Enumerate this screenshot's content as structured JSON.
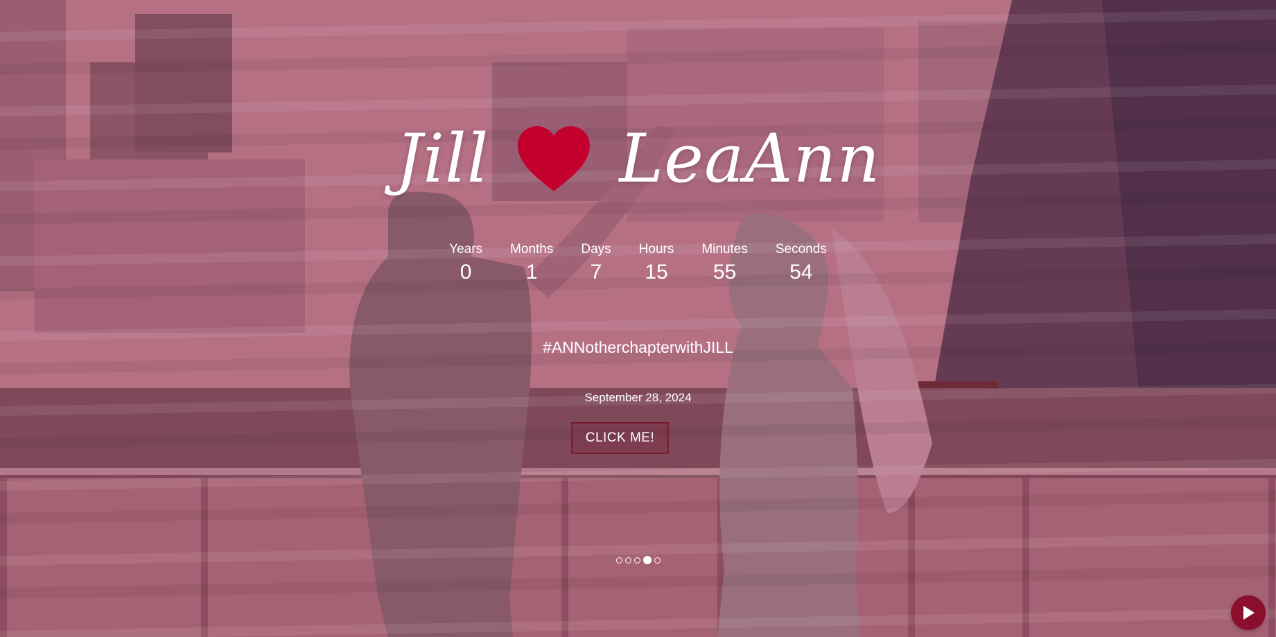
{
  "hero": {
    "name_left": "Jill",
    "name_right": "LeaAnn",
    "heart_icon": "heart-icon",
    "heart_color": "#c4002f",
    "overlay_color": "#d66e8c"
  },
  "countdown": [
    {
      "label": "Years",
      "value": "0"
    },
    {
      "label": "Months",
      "value": "1"
    },
    {
      "label": "Days",
      "value": "7"
    },
    {
      "label": "Hours",
      "value": "15"
    },
    {
      "label": "Minutes",
      "value": "55"
    },
    {
      "label": "Seconds",
      "value": "54"
    }
  ],
  "hashtag": "#ANNotherchapterwithJILL",
  "date": "September 28, 2024",
  "cta": {
    "label": "CLICK ME!",
    "border_color": "#7a1b34"
  },
  "slider": {
    "count": 5,
    "active_index": 3
  },
  "music_button": {
    "icon": "play-icon",
    "color": "#8a0f2c"
  }
}
